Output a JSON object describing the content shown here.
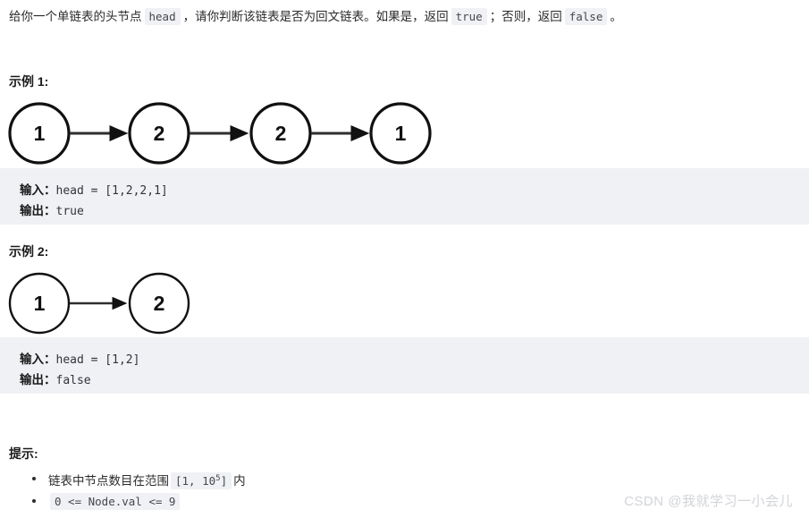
{
  "statement": {
    "part1": "给你一个单链表的头节点",
    "code_head": "head",
    "part2": "，请你判断该链表是否为回文链表。如果是，返回",
    "code_true": "true",
    "part3": "；否则，返回",
    "code_false": "false",
    "part4": "。"
  },
  "examples": [
    {
      "heading": "示例 1:",
      "nodes": [
        "1",
        "2",
        "2",
        "1"
      ],
      "input_label": "输入：",
      "input_value": "head = [1,2,2,1]",
      "output_label": "输出：",
      "output_value": "true"
    },
    {
      "heading": "示例 2:",
      "nodes": [
        "1",
        "2"
      ],
      "input_label": "输入：",
      "input_value": "head = [1,2]",
      "output_label": "输出：",
      "output_value": "false"
    }
  ],
  "hints": {
    "heading": "提示:",
    "items": [
      {
        "text_before": "链表中节点数目在范围",
        "code_base": "[1, 10",
        "code_exp": "5",
        "code_close": "]",
        "text_after": "内"
      },
      {
        "code_only": "0 <= Node.val <= 9"
      }
    ]
  },
  "watermark": "CSDN @我就学习一小会儿",
  "colors": {
    "code_background": "#f0f1f4",
    "node_stroke": "#111111",
    "text": "#2b2b2b",
    "watermark": "#d2d4d8"
  }
}
